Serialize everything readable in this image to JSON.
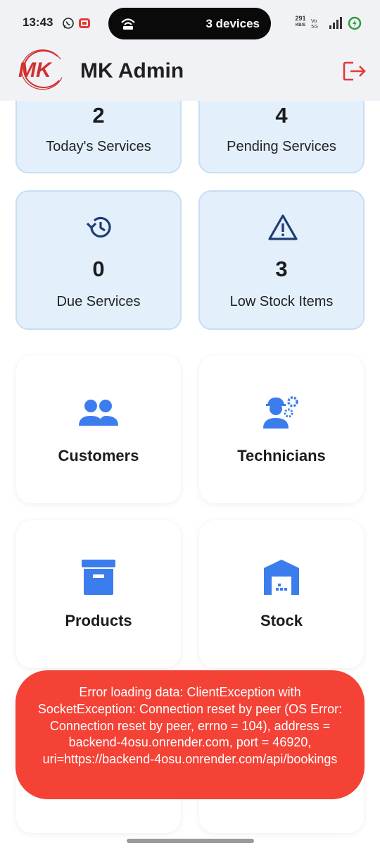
{
  "status_bar": {
    "time": "13:43",
    "island_text": "3 devices",
    "net_speed_value": "291",
    "net_speed_unit": "KB/S"
  },
  "app_bar": {
    "logo_text": "MK",
    "title": "MK Admin"
  },
  "stats": [
    {
      "value": "2",
      "label": "Today's Services"
    },
    {
      "value": "4",
      "label": "Pending Services"
    },
    {
      "value": "0",
      "label": "Due Services",
      "icon": "history-icon"
    },
    {
      "value": "3",
      "label": "Low Stock Items",
      "icon": "warning-icon"
    }
  ],
  "nav": [
    {
      "label": "Customers",
      "icon": "people-icon"
    },
    {
      "label": "Technicians",
      "icon": "engineer-icon"
    },
    {
      "label": "Products",
      "icon": "archive-box-icon"
    },
    {
      "label": "Stock",
      "icon": "warehouse-icon"
    }
  ],
  "toast": {
    "message": "Error loading data: ClientException with SocketException: Connection reset by peer (OS Error: Connection reset by peer, errno = 104), address = backend-4osu.onrender.com, port = 46920, uri=https://backend-4osu.onrender.com/api/bookings"
  },
  "colors": {
    "accent_blue": "#3b7ded",
    "dark_blue": "#1f3d73",
    "card_bg": "#e3f0fc",
    "error_red": "#f44236",
    "logout_red": "#e53935"
  }
}
